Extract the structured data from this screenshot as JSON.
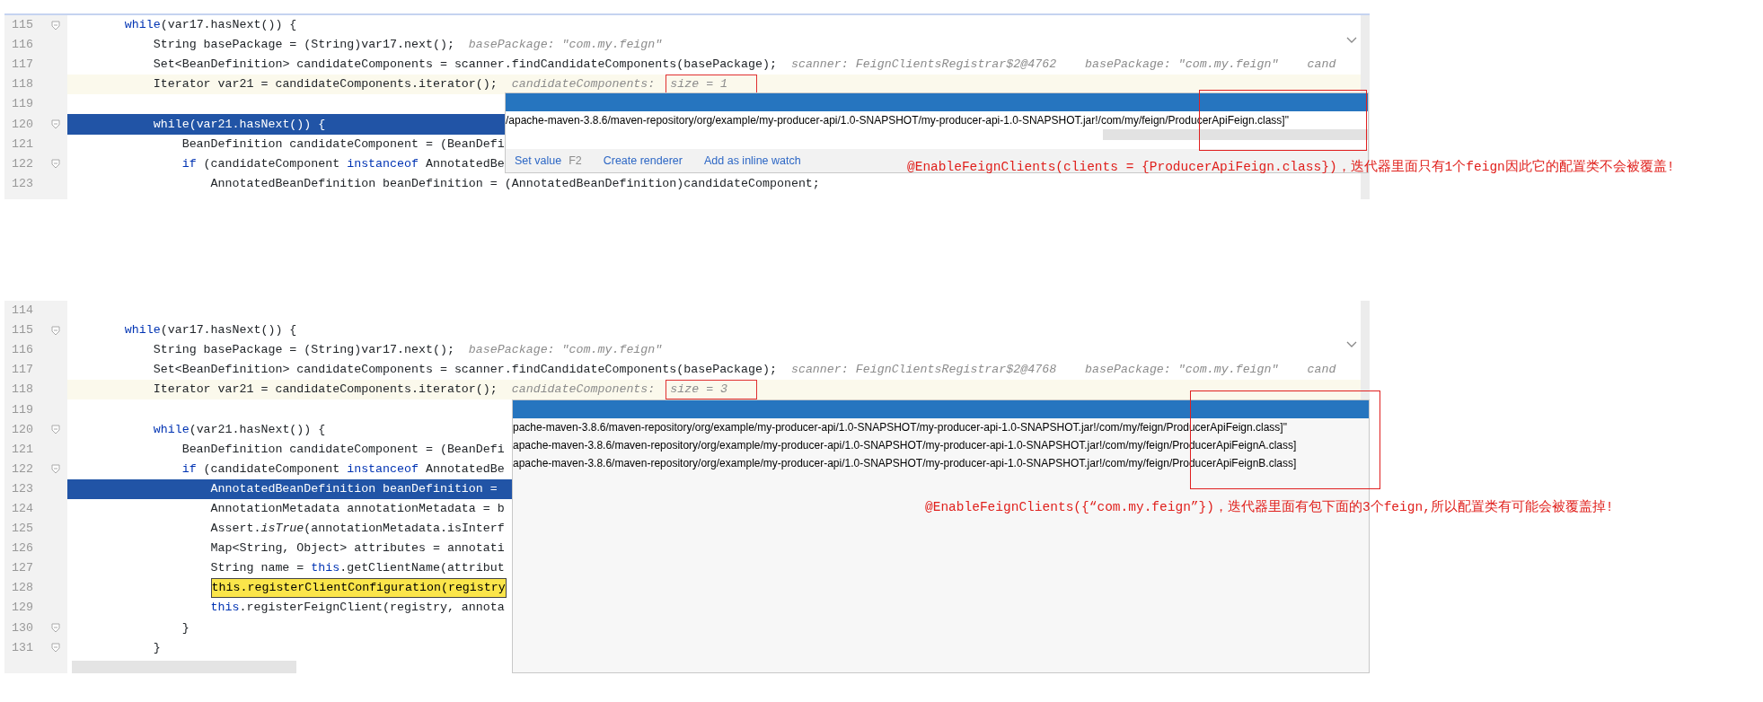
{
  "panels": [
    {
      "lines": [
        {
          "number": "115",
          "fold": true,
          "current": false,
          "execution": false,
          "tokens": [
            {
              "kind": "keyword",
              "text": "        while"
            },
            {
              "kind": "code",
              "text": "(var17.hasNext()) {"
            }
          ]
        },
        {
          "number": "116",
          "fold": false,
          "current": false,
          "execution": false,
          "tokens": [
            {
              "kind": "code",
              "text": "            String basePackage = (String)var17.next();"
            },
            {
              "kind": "hint",
              "text": "basePackage: \"com.my.feign\""
            }
          ]
        },
        {
          "number": "117",
          "fold": false,
          "current": false,
          "execution": false,
          "tokens": [
            {
              "kind": "code",
              "text": "            Set<BeanDefinition> candidateComponents = scanner.findCandidateComponents(basePackage);"
            },
            {
              "kind": "hint",
              "text": "scanner: FeignClientsRegistrar$2@4762"
            },
            {
              "kind": "hint",
              "text": "basePackage: \"com.my.feign\""
            },
            {
              "kind": "hint",
              "text": "cand"
            }
          ]
        },
        {
          "number": "118",
          "fold": false,
          "current": true,
          "execution": false,
          "tokens": [
            {
              "kind": "code",
              "text": "            Iterator var21 = candidateComponents.iterator();"
            },
            {
              "kind": "hint",
              "text": "candidateComponents:"
            },
            {
              "kind": "boxed-hint",
              "text": "size = 1"
            }
          ]
        },
        {
          "number": "119",
          "fold": false,
          "current": false,
          "execution": false
        },
        {
          "number": "120",
          "fold": true,
          "current": false,
          "execution": true,
          "tokens": [
            {
              "kind": "keyword",
              "text": "            while"
            },
            {
              "kind": "code",
              "text": "(var21.hasNext()) {"
            }
          ]
        },
        {
          "number": "121",
          "fold": false,
          "current": false,
          "execution": false,
          "tokens": [
            {
              "kind": "code",
              "text": "                BeanDefinition candidateComponent = (BeanDefi"
            }
          ]
        },
        {
          "number": "122",
          "fold": true,
          "current": false,
          "execution": false,
          "tokens": [
            {
              "kind": "keyword",
              "text": "                if"
            },
            {
              "kind": "code",
              "text": "(candidateComponent"
            },
            {
              "kind": "keyword",
              "text": "instanceof"
            },
            {
              "kind": "code",
              "text": "AnnotatedBe"
            }
          ]
        },
        {
          "number": "123",
          "fold": false,
          "current": false,
          "execution": false,
          "tokens": [
            {
              "kind": "code",
              "text": "                    AnnotatedBeanDefinition beanDefinition = (AnnotatedBeanDefinition)candidateComponent;"
            }
          ]
        }
      ],
      "popup": {
        "values": [
          "/apache-maven-3.8.6/maven-repository/org/example/my-producer-api/1.0-SNAPSHOT/my-producer-api-1.0-SNAPSHOT.jar!/com/my/feign/ProducerApiFeign.class]\""
        ],
        "actions": [
          {
            "label": "Set value",
            "shortcut": "F2"
          },
          {
            "label": "Create renderer"
          },
          {
            "label": "Add as inline watch"
          }
        ]
      },
      "annotation": "@EnableFeignClients(clients = {ProducerApiFeign.class})，迭代器里面只有1个feign因此它的配置类不会被覆盖!"
    },
    {
      "lines": [
        {
          "number": "114",
          "fold": false,
          "current": false,
          "execution": false
        },
        {
          "number": "115",
          "fold": true,
          "current": false,
          "execution": false,
          "tokens": [
            {
              "kind": "keyword",
              "text": "        while"
            },
            {
              "kind": "code",
              "text": "(var17.hasNext()) {"
            }
          ]
        },
        {
          "number": "116",
          "fold": false,
          "current": false,
          "execution": false,
          "tokens": [
            {
              "kind": "code",
              "text": "            String basePackage = (String)var17.next();"
            },
            {
              "kind": "hint",
              "text": "basePackage: \"com.my.feign\""
            }
          ]
        },
        {
          "number": "117",
          "fold": false,
          "current": false,
          "execution": false,
          "tokens": [
            {
              "kind": "code",
              "text": "            Set<BeanDefinition> candidateComponents = scanner.findCandidateComponents(basePackage);"
            },
            {
              "kind": "hint",
              "text": "scanner: FeignClientsRegistrar$2@4768"
            },
            {
              "kind": "hint",
              "text": "basePackage: \"com.my.feign\""
            },
            {
              "kind": "hint",
              "text": "cand"
            }
          ]
        },
        {
          "number": "118",
          "fold": false,
          "current": true,
          "execution": false,
          "tokens": [
            {
              "kind": "code",
              "text": "            Iterator var21 = candidateComponents.iterator();"
            },
            {
              "kind": "hint",
              "text": "candidateComponents:"
            },
            {
              "kind": "boxed-hint",
              "text": "size = 3"
            }
          ]
        },
        {
          "number": "119",
          "fold": false,
          "current": false,
          "execution": false
        },
        {
          "number": "120",
          "fold": true,
          "current": false,
          "execution": false,
          "tokens": [
            {
              "kind": "keyword",
              "text": "            while"
            },
            {
              "kind": "code",
              "text": "(var21.hasNext()) {"
            }
          ]
        },
        {
          "number": "121",
          "fold": false,
          "current": false,
          "execution": false,
          "tokens": [
            {
              "kind": "code",
              "text": "                BeanDefinition candidateComponent = (BeanDefi"
            }
          ]
        },
        {
          "number": "122",
          "fold": true,
          "current": false,
          "execution": false,
          "tokens": [
            {
              "kind": "keyword",
              "text": "                if"
            },
            {
              "kind": "code",
              "text": "(candidateComponent"
            },
            {
              "kind": "keyword",
              "text": "instanceof"
            },
            {
              "kind": "code",
              "text": "AnnotatedBe"
            }
          ]
        },
        {
          "number": "123",
          "fold": false,
          "current": false,
          "execution": true,
          "tokens": [
            {
              "kind": "code",
              "text": "                    AnnotatedBeanDefinition beanDefinition ="
            }
          ]
        },
        {
          "number": "124",
          "fold": false,
          "current": false,
          "execution": false,
          "tokens": [
            {
              "kind": "code",
              "text": "                    AnnotationMetadata annotationMetadata = b"
            }
          ]
        },
        {
          "number": "125",
          "fold": false,
          "current": false,
          "execution": false,
          "tokens": [
            {
              "kind": "code",
              "text": "                    Assert."
            },
            {
              "kind": "italic",
              "text": "isTrue"
            },
            {
              "kind": "code",
              "text": "(annotationMetadata.isInterf"
            }
          ]
        },
        {
          "number": "126",
          "fold": false,
          "current": false,
          "execution": false,
          "tokens": [
            {
              "kind": "code",
              "text": "                    Map<String, Object> attributes = annotati"
            }
          ]
        },
        {
          "number": "127",
          "fold": false,
          "current": false,
          "execution": false,
          "tokens": [
            {
              "kind": "code",
              "text": "                    String name ="
            },
            {
              "kind": "keyword",
              "text": "this"
            },
            {
              "kind": "code",
              "text": ".getClientName(attribut"
            }
          ]
        },
        {
          "number": "128",
          "fold": false,
          "current": false,
          "execution": false,
          "tokens": [
            {
              "kind": "match",
              "text": "                    this.registerClientConfiguration(registry"
            }
          ]
        },
        {
          "number": "129",
          "fold": false,
          "current": false,
          "execution": false,
          "tokens": [
            {
              "kind": "keyword",
              "text": "                    this"
            },
            {
              "kind": "code",
              "text": ".registerFeignClient(registry, annota"
            }
          ]
        },
        {
          "number": "130",
          "fold": true,
          "current": false,
          "execution": false,
          "tokens": [
            {
              "kind": "code",
              "text": "                }"
            }
          ]
        },
        {
          "number": "131",
          "fold": true,
          "current": false,
          "execution": false,
          "tokens": [
            {
              "kind": "code",
              "text": "            }"
            }
          ]
        }
      ],
      "popup": {
        "values": [
          "pache-maven-3.8.6/maven-repository/org/example/my-producer-api/1.0-SNAPSHOT/my-producer-api-1.0-SNAPSHOT.jar!/com/my/feign/ProducerApiFeign.class]\"",
          "apache-maven-3.8.6/maven-repository/org/example/my-producer-api/1.0-SNAPSHOT/my-producer-api-1.0-SNAPSHOT.jar!/com/my/feign/ProducerApiFeignA.class]",
          "apache-maven-3.8.6/maven-repository/org/example/my-producer-api/1.0-SNAPSHOT/my-producer-api-1.0-SNAPSHOT.jar!/com/my/feign/ProducerApiFeignB.class]"
        ]
      },
      "annotation": "@EnableFeignClients({“com.my.feign”})，迭代器里面有包下面的3个feign,所以配置类有可能会被覆盖掉!"
    }
  ]
}
